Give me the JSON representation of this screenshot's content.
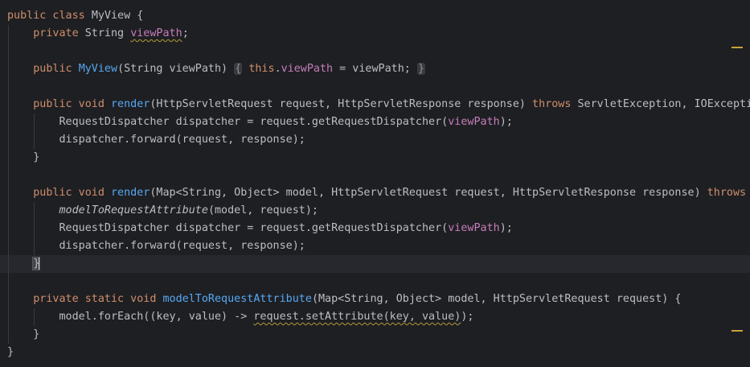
{
  "editor": {
    "lines": [
      {
        "indent": 0,
        "tokens": [
          {
            "t": "public class ",
            "c": "kw"
          },
          {
            "t": "MyView {",
            "c": ""
          }
        ]
      },
      {
        "indent": 1,
        "tokens": [
          {
            "t": "private ",
            "c": "kw"
          },
          {
            "t": "String ",
            "c": ""
          },
          {
            "t": "viewPath",
            "c": "fld warn"
          },
          {
            "t": ";",
            "c": ""
          }
        ]
      },
      {
        "indent": 0,
        "tokens": []
      },
      {
        "indent": 1,
        "tokens": [
          {
            "t": "public ",
            "c": "kw"
          },
          {
            "t": "MyView",
            "c": "fn"
          },
          {
            "t": "(String viewPath) ",
            "c": ""
          },
          {
            "t": "{",
            "c": "fold"
          },
          {
            "t": " ",
            "c": ""
          },
          {
            "t": "this",
            "c": "kw"
          },
          {
            "t": ".",
            "c": ""
          },
          {
            "t": "viewPath",
            "c": "fld"
          },
          {
            "t": " = viewPath; ",
            "c": ""
          },
          {
            "t": "}",
            "c": "fold"
          }
        ]
      },
      {
        "indent": 0,
        "tokens": []
      },
      {
        "indent": 1,
        "tokens": [
          {
            "t": "public void ",
            "c": "kw"
          },
          {
            "t": "render",
            "c": "fn"
          },
          {
            "t": "(HttpServletRequest request, HttpServletResponse response) ",
            "c": ""
          },
          {
            "t": "throws ",
            "c": "kw"
          },
          {
            "t": "ServletException, IOException",
            "c": ""
          }
        ]
      },
      {
        "indent": 2,
        "tokens": [
          {
            "t": "RequestDispatcher dispatcher = request.getRequestDispatcher(",
            "c": ""
          },
          {
            "t": "viewPath",
            "c": "fld"
          },
          {
            "t": ");",
            "c": ""
          }
        ]
      },
      {
        "indent": 2,
        "tokens": [
          {
            "t": "dispatcher.forward(request, response);",
            "c": ""
          }
        ]
      },
      {
        "indent": 1,
        "tokens": [
          {
            "t": "}",
            "c": ""
          }
        ]
      },
      {
        "indent": 0,
        "tokens": []
      },
      {
        "indent": 1,
        "tokens": [
          {
            "t": "public void ",
            "c": "kw"
          },
          {
            "t": "render",
            "c": "fn"
          },
          {
            "t": "(Map<String, Object> model, HttpServletRequest request, HttpServletResponse response) ",
            "c": ""
          },
          {
            "t": "throws",
            "c": "kw"
          }
        ]
      },
      {
        "indent": 2,
        "tokens": [
          {
            "t": "modelToRequestAttribute",
            "c": "it"
          },
          {
            "t": "(model, request);",
            "c": ""
          }
        ]
      },
      {
        "indent": 2,
        "tokens": [
          {
            "t": "RequestDispatcher dispatcher = request.getRequestDispatcher(",
            "c": ""
          },
          {
            "t": "viewPath",
            "c": "fld"
          },
          {
            "t": ");",
            "c": ""
          }
        ]
      },
      {
        "indent": 2,
        "tokens": [
          {
            "t": "dispatcher.forward(request, response);",
            "c": ""
          }
        ]
      },
      {
        "indent": 1,
        "caret": true,
        "tokens": [
          {
            "t": "}",
            "c": "brace-hl"
          }
        ]
      },
      {
        "indent": 0,
        "tokens": []
      },
      {
        "indent": 1,
        "tokens": [
          {
            "t": "private static void ",
            "c": "kw"
          },
          {
            "t": "modelToRequestAttribute",
            "c": "fn"
          },
          {
            "t": "(Map<String, Object> model, HttpServletRequest request) {",
            "c": ""
          }
        ]
      },
      {
        "indent": 2,
        "tokens": [
          {
            "t": "model.forEach((key, value) -> ",
            "c": ""
          },
          {
            "t": "request.setAttribute(key, value)",
            "c": "warn"
          },
          {
            "t": ");",
            "c": ""
          }
        ]
      },
      {
        "indent": 1,
        "tokens": [
          {
            "t": "}",
            "c": ""
          }
        ]
      },
      {
        "indent": 0,
        "tokens": [
          {
            "t": "}",
            "c": ""
          }
        ]
      }
    ]
  },
  "colors": {
    "background": "#1e1f22",
    "keyword": "#cf8e6d",
    "field": "#c77dbb",
    "method": "#56a8f5",
    "text": "#bcbec4",
    "warning": "#c9a23a"
  }
}
